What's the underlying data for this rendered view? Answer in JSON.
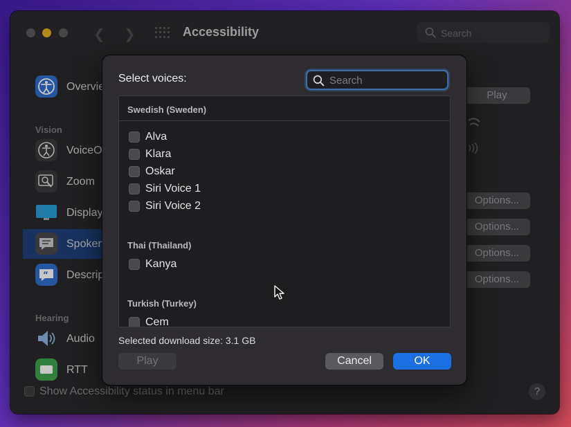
{
  "window": {
    "title": "Accessibility",
    "search_placeholder": "Search"
  },
  "sidebar": {
    "overview": "Overview",
    "vision_heading": "Vision",
    "items": [
      "VoiceOver",
      "Zoom",
      "Display",
      "Spoken Content",
      "Descriptions"
    ],
    "hearing_heading": "Hearing",
    "hearing_items": [
      "Audio",
      "RTT"
    ]
  },
  "right_panel": {
    "play_label": "Play",
    "options_label": "Options..."
  },
  "footer": {
    "show_status_label": "Show Accessibility status in menu bar",
    "help_label": "?"
  },
  "dialog": {
    "title": "Select voices:",
    "search_placeholder": "Search",
    "groups": [
      {
        "name": "Swedish (Sweden)",
        "voices": [
          "Alva",
          "Klara",
          "Oskar",
          "Siri Voice 1",
          "Siri Voice 2"
        ]
      },
      {
        "name": "Thai (Thailand)",
        "voices": [
          "Kanya"
        ]
      },
      {
        "name": "Turkish (Turkey)",
        "voices": [
          "Cem"
        ]
      }
    ],
    "download_size": "Selected download size: 3.1 GB",
    "play_label": "Play",
    "cancel_label": "Cancel",
    "ok_label": "OK"
  },
  "colors": {
    "accent": "#1b6fe0",
    "window_bg": "#2a2a2c",
    "sidebar_selected": "#1f3f7a"
  }
}
